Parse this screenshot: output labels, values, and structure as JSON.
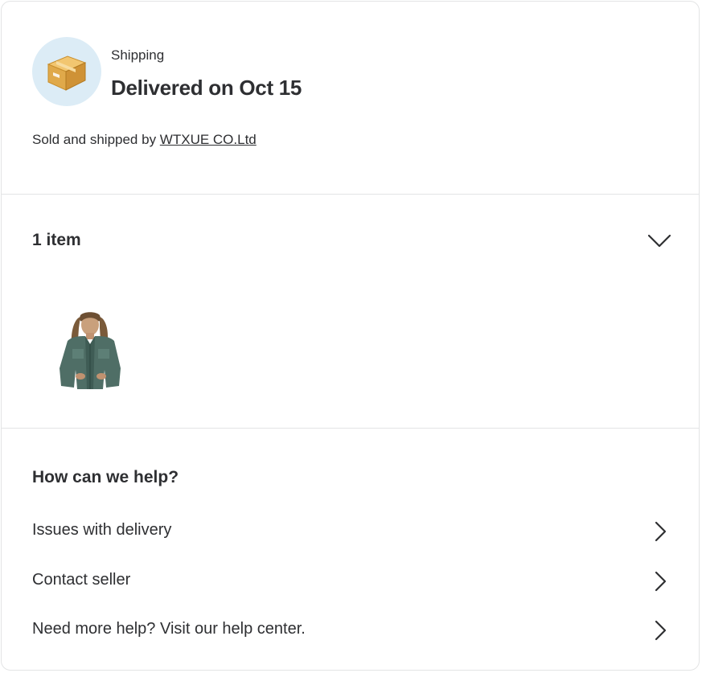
{
  "shipping": {
    "label": "Shipping",
    "status": "Delivered on Oct 15",
    "sold_by_prefix": "Sold and shipped by",
    "seller_name": "WTXUE CO.Ltd"
  },
  "items": {
    "header": "1 item",
    "toggle_icon": "chevron-down-icon",
    "thumbnail_alt": "Green denim shirt"
  },
  "help": {
    "title": "How can we help?",
    "options": [
      {
        "label": "Issues with delivery",
        "icon": "chevron-right-icon"
      },
      {
        "label": "Contact seller",
        "icon": "chevron-right-icon"
      },
      {
        "label": "Need more help? Visit our help center.",
        "icon": "chevron-right-icon"
      }
    ]
  },
  "colors": {
    "text": "#2e2f32",
    "divider": "#e3e4e5",
    "icon_bg": "#dcecf6",
    "box": "#e0a94a"
  }
}
